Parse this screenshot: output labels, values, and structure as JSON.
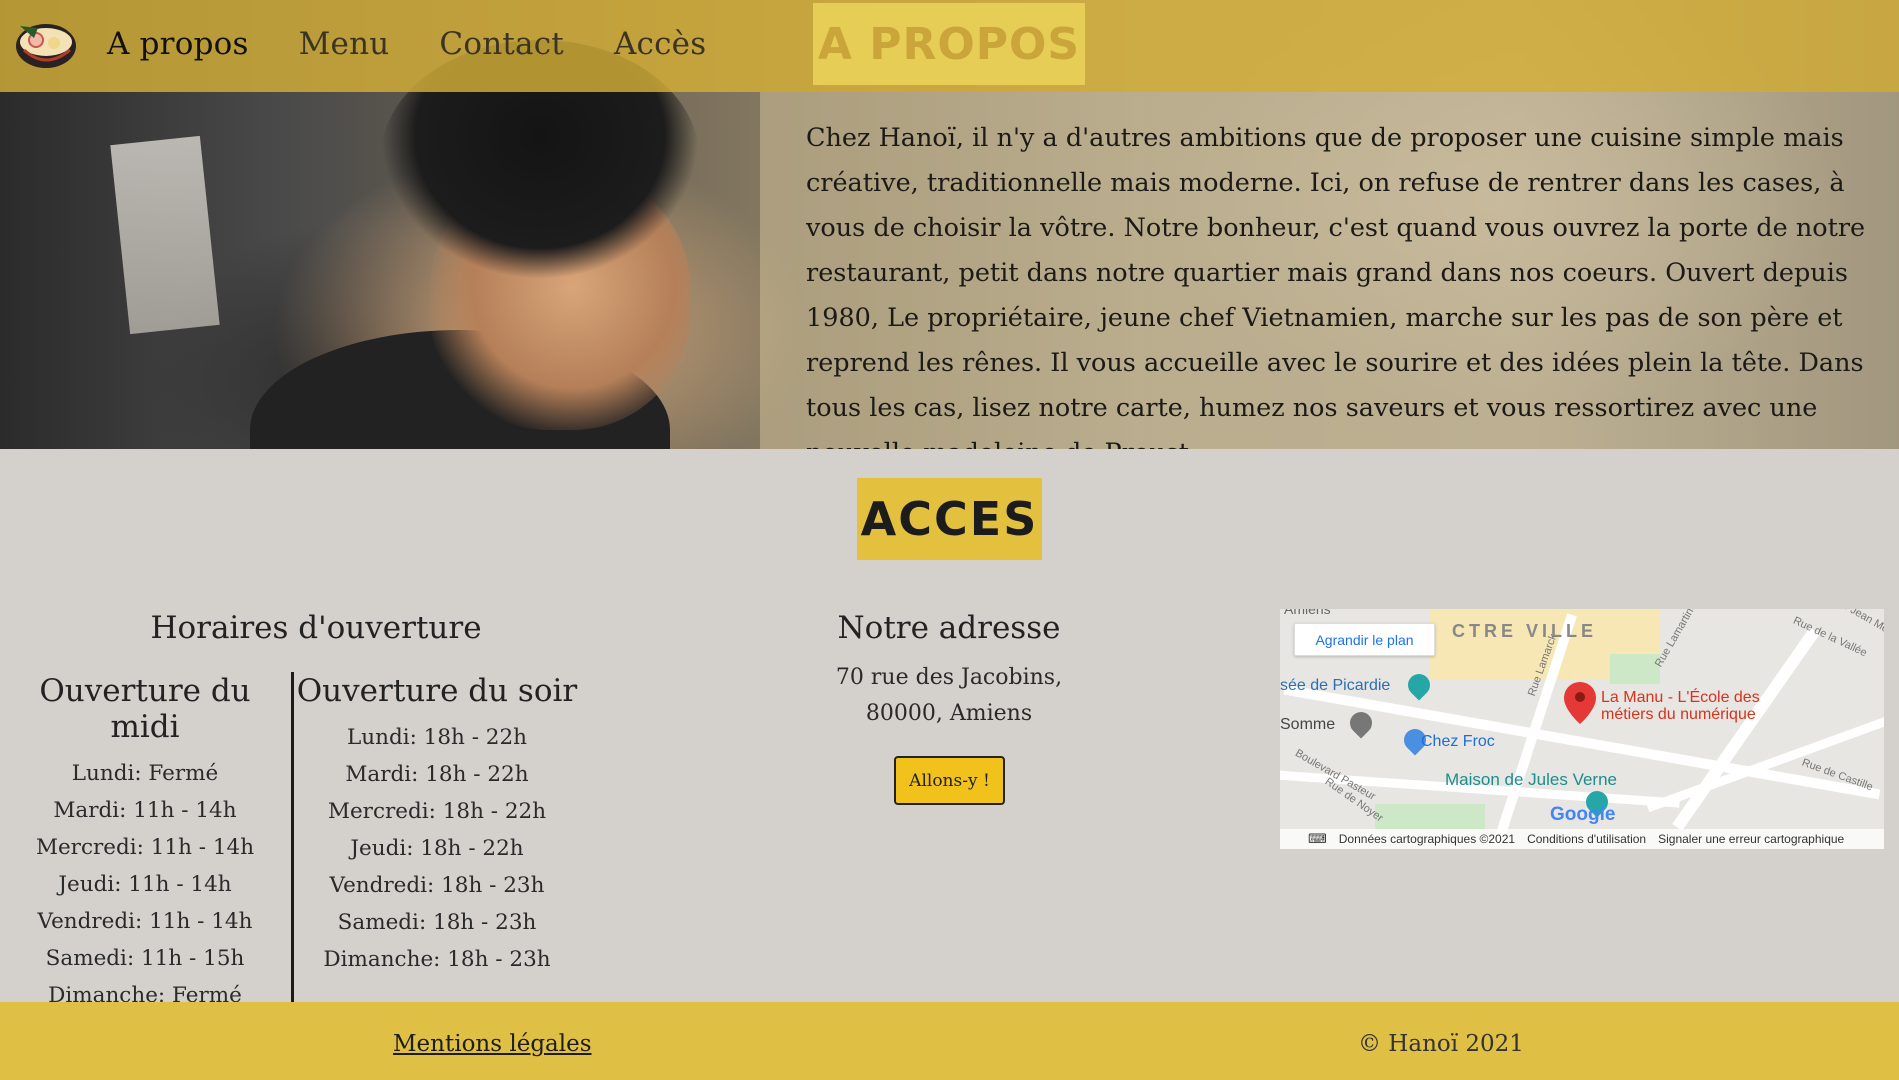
{
  "nav": {
    "items": [
      {
        "label": "A propos"
      },
      {
        "label": "Menu"
      },
      {
        "label": "Contact"
      },
      {
        "label": "Accès"
      }
    ]
  },
  "apropos": {
    "title": "A PROPOS",
    "text": "Chez Hanoï, il n'y a d'autres ambitions que de proposer une cuisine simple mais créative, traditionnelle mais moderne. Ici, on refuse de rentrer dans les cases, à vous de choisir la vôtre. Notre bonheur, c'est quand vous ouvrez la porte de notre restaurant, petit dans notre quartier mais grand dans nos coeurs. Ouvert depuis 1980, Le propriétaire, jeune chef Vietnamien, marche sur les pas de son père et reprend les rênes. Il vous accueille avec le sourire et des idées plein la tête. Dans tous les cas, lisez notre carte, humez nos saveurs et vous ressortirez avec une nouvelle madeleine de Proust."
  },
  "acces": {
    "title": "ACCES",
    "hours_heading": "Horaires d'ouverture",
    "midi": {
      "title": "Ouverture du midi",
      "rows": [
        "Lundi: Fermé",
        "Mardi: 11h - 14h",
        "Mercredi: 11h - 14h",
        "Jeudi: 11h - 14h",
        "Vendredi: 11h - 14h",
        "Samedi: 11h - 15h",
        "Dimanche: Fermé"
      ]
    },
    "soir": {
      "title": "Ouverture du soir",
      "rows": [
        "Lundi: 18h - 22h",
        "Mardi: 18h - 22h",
        "Mercredi: 18h - 22h",
        "Jeudi: 18h - 22h",
        "Vendredi: 18h - 23h",
        "Samedi: 18h - 23h",
        "Dimanche: 18h - 23h"
      ]
    },
    "address_heading": "Notre adresse",
    "address_line1": "70 rue des Jacobins,",
    "address_line2": "80000, Amiens",
    "button_label": "Allons-y !"
  },
  "map": {
    "enlarge_label": "Agrandir le plan",
    "labels": {
      "centre": "CTRE VILLE",
      "musee": "sée de Picardie",
      "somme": "Somme",
      "chez_froc": "Chez Froc",
      "jules_verne": "Maison de Jules Verne",
      "la_manu_1": "La Manu - L'École des",
      "la_manu_2": "métiers du numérique",
      "amiens": "Amiens",
      "rue_lamarck": "Rue Lamarck",
      "rue_vallee": "Rue de la Vallée",
      "rue_castille": "Rue de Castille",
      "bd_pasteur": "Boulevard Pasteur",
      "rue_noyer": "Rue de Noyer",
      "rue_jean": "Rue Jean Mermoz",
      "rue_lamartine": "Rue Lamartine"
    },
    "footer": {
      "data": "Données cartographiques ©2021",
      "terms": "Conditions d'utilisation",
      "report": "Signaler une erreur cartographique"
    },
    "google": "Google"
  },
  "footer": {
    "legal": "Mentions légales",
    "copyright": "© Hanoï 2021"
  },
  "colors": {
    "accent": "#e3c13e",
    "button": "#f1c21b",
    "background": "#d4d0cc",
    "map_pin": "#e53935",
    "poi_blue": "#4a8fe0",
    "poi_teal": "#26a6a6"
  }
}
